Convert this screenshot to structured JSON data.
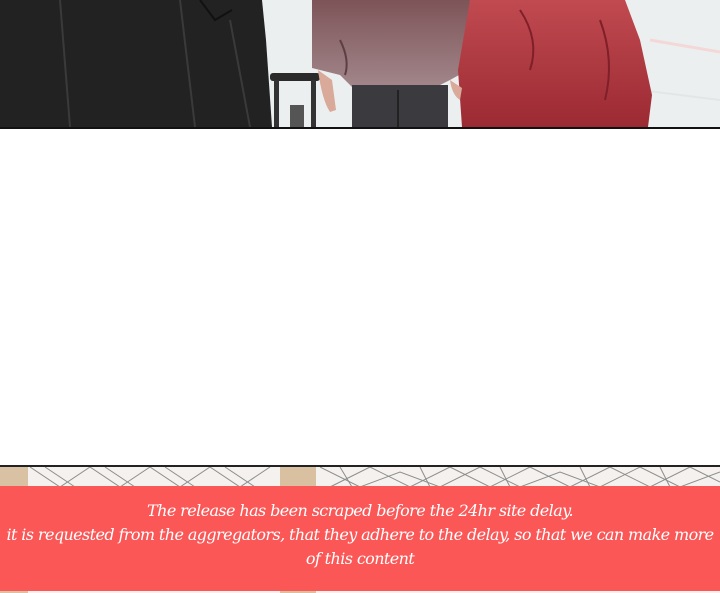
{
  "notice": {
    "line1": "The release has been scraped before the 24hr site delay.",
    "line2": "it is requested from the aggregators, that they adhere to the delay, so that we can make more of this content",
    "background_color": "#fb5757",
    "text_color": "#ffffff"
  },
  "top_panel": {
    "figures": [
      "person-black-coat",
      "person-mauve-jacket",
      "person-red-jacket"
    ],
    "props": [
      "rolling-suitcase-handle"
    ]
  },
  "bottom_panel": {
    "pattern": "geometric-triangle-lines"
  }
}
